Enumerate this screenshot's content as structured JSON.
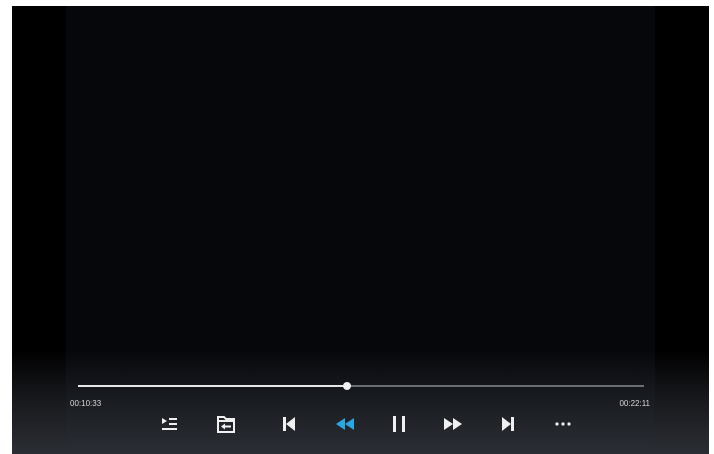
{
  "player": {
    "elapsed_time": "00:10:33",
    "total_time": "00:22:11",
    "progress_fraction": 0.475
  },
  "controls": [
    {
      "name": "playlist-button",
      "icon": "playlist-icon"
    },
    {
      "name": "open-folder-button",
      "icon": "folder-back-icon"
    },
    {
      "name": "previous-button",
      "icon": "skip-previous-icon"
    },
    {
      "name": "rewind-button",
      "icon": "rewind-icon",
      "active": true
    },
    {
      "name": "pause-button",
      "icon": "pause-icon"
    },
    {
      "name": "fast-forward-button",
      "icon": "fast-forward-icon"
    },
    {
      "name": "next-button",
      "icon": "skip-next-icon"
    },
    {
      "name": "more-button",
      "icon": "more-horizontal-icon"
    }
  ],
  "colors": {
    "background": "#000000",
    "video_area": "#05070b",
    "icon": "#f0f0f0",
    "accent": "#2aa6e0",
    "track": "#6a6d72",
    "played": "#e6e6e6"
  }
}
